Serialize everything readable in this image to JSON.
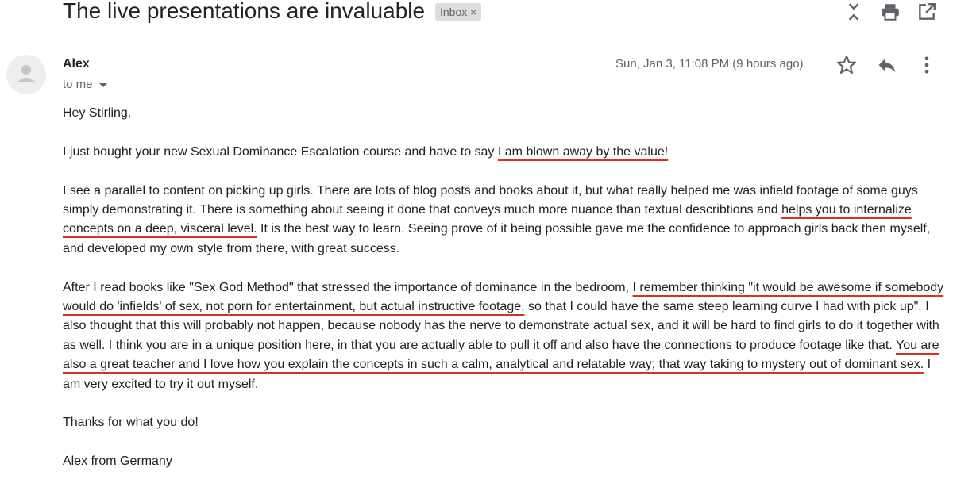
{
  "subject": "The live presentations are invaluable",
  "label": "Inbox",
  "label_remove": "×",
  "sender": "Alex",
  "recipient": "to me",
  "date": "Sun, Jan 3, 11:08 PM (9 hours ago)",
  "icons": {
    "collapse": "collapse-icon",
    "print": "print-icon",
    "open_new_window": "open-in-new-icon",
    "star": "star-icon",
    "reply": "reply-icon",
    "more": "more-vert-icon",
    "avatar": "person-icon"
  },
  "body": {
    "greeting": "Hey Stirling,",
    "p1": {
      "a": "I just bought your new Sexual Dominance Escalation course and have to say ",
      "b": "I am blown away by the value!"
    },
    "p2": {
      "a": "I see a parallel to content on picking up girls. There are lots of blog posts and books about it, but what really helped me was infield footage of some guys simply demonstrating it. There is something about seeing it done that conveys much more nuance than textual describtions and ",
      "b": "helps you to internalize concepts on a deep, visceral level.",
      "c": " It is the best way to learn. Seeing prove of it being possible gave me the confidence to approach girls back then myself, and developed my own style from there, with great success."
    },
    "p3": {
      "a": "After I read books like \"Sex God Method\" that stressed the importance of dominance in the bedroom, ",
      "b": "I remember thinking \"it would be awesome if somebody would do 'infields' of sex, not porn for entertainment, but actual instructive footage,",
      "c": " so that I could have the same steep learning curve I had with pick up\". I also thought that this will probably not happen, because nobody has the nerve to demonstrate actual sex, and it will be hard to find girls to do it together with as well. I think you are in a unique position here, in that you are actually able to pull it off and also have the connections to produce footage like that. ",
      "d": "You are also a great teacher and I love how you explain the concepts in such a calm, analytical and relatable way; that way taking to mystery out of dominant sex.",
      "e": " I am very excited to try it out myself."
    },
    "thanks": "Thanks for what you do!",
    "signature": "Alex from Germany"
  },
  "colors": {
    "underline": "#d93025",
    "chip_bg": "#dddddd",
    "muted_text": "#5f6368"
  }
}
